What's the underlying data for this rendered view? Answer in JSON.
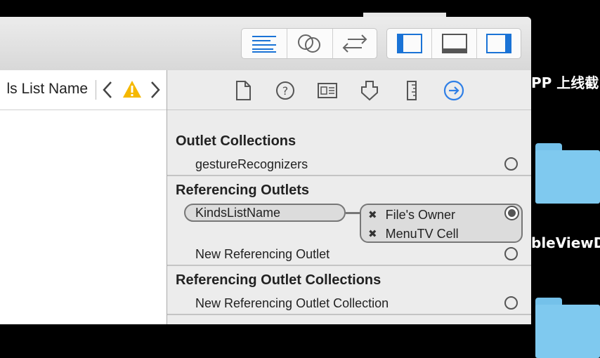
{
  "desktop": {
    "text1": "PP 上线截",
    "text2": "bleViewD"
  },
  "toolbar": {
    "editor_modes": [
      "standard-editor-icon",
      "assistant-editor-icon",
      "version-editor-icon"
    ],
    "view_toggles": [
      "navigator-toggle-icon",
      "debug-area-toggle-icon",
      "utilities-toggle-icon"
    ],
    "accent": "#1a73d6"
  },
  "jumpbar": {
    "label": "ls List Name"
  },
  "inspector": {
    "tabs": [
      "file-inspector-icon",
      "quick-help-icon",
      "identity-inspector-icon",
      "attributes-inspector-icon",
      "size-inspector-icon",
      "connections-inspector-icon"
    ],
    "active_tab_color": "#2f7fe6",
    "outlet_collections": {
      "title": "Outlet Collections",
      "item": "gestureRecognizers"
    },
    "referencing_outlets": {
      "title": "Referencing Outlets",
      "outlet_name": "KindsListName",
      "targets": [
        "File's Owner",
        "MenuTV Cell"
      ],
      "new_item": "New Referencing Outlet"
    },
    "referencing_outlet_collections": {
      "title": "Referencing Outlet Collections",
      "new_item": "New Referencing Outlet Collection"
    },
    "remove_glyph": "✖"
  }
}
